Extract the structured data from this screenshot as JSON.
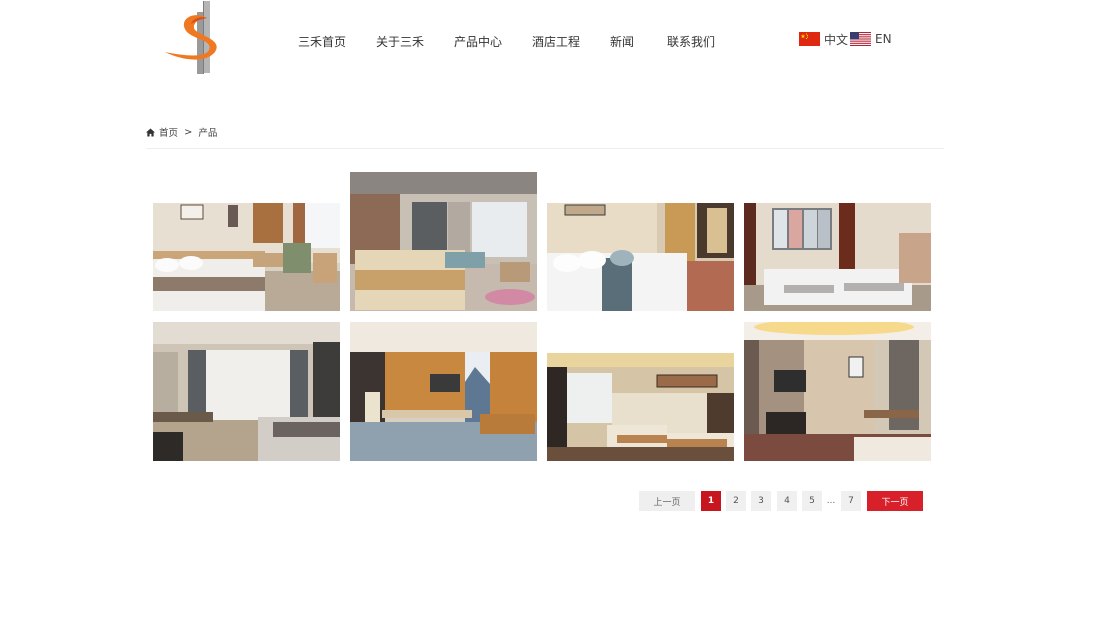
{
  "nav": {
    "items": [
      "三禾首页",
      "关于三禾",
      "产品中心",
      "酒店工程",
      "新闻",
      "联系我们"
    ]
  },
  "lang": {
    "zh": "中文",
    "en": "EN"
  },
  "breadcrumb": {
    "home": "首页",
    "separator": ">",
    "current": "产品"
  },
  "pagination": {
    "prev": "上一页",
    "pages": [
      "1",
      "2",
      "3",
      "4",
      "5"
    ],
    "ellipsis": "...",
    "last": "7",
    "next": "下一页",
    "current": "1"
  },
  "colors": {
    "accent": "#c8161e",
    "next_button": "#d8202a"
  }
}
